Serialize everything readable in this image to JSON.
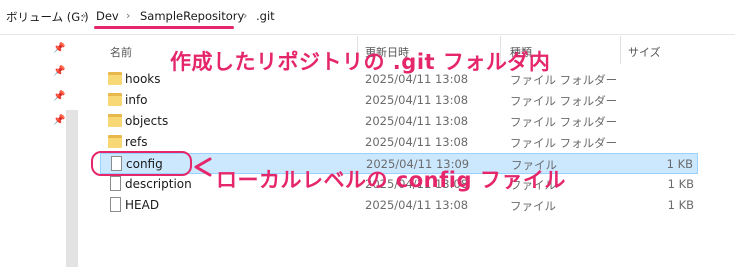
{
  "address_bar": {
    "drive": "ボリューム (G:)",
    "path": [
      "Dev",
      "SampleRepository",
      ".git"
    ],
    "separator": "›"
  },
  "columns": {
    "name": "名前",
    "date": "更新日時",
    "type": "種類",
    "size": "サイズ"
  },
  "rows": [
    {
      "name": "hooks",
      "date": "2025/04/11 13:08",
      "type": "ファイル フォルダー",
      "size": "",
      "icon": "folder-icon"
    },
    {
      "name": "info",
      "date": "2025/04/11 13:08",
      "type": "ファイル フォルダー",
      "size": "",
      "icon": "folder-icon"
    },
    {
      "name": "objects",
      "date": "2025/04/11 13:08",
      "type": "ファイル フォルダー",
      "size": "",
      "icon": "folder-icon"
    },
    {
      "name": "refs",
      "date": "2025/04/11 13:08",
      "type": "ファイル フォルダー",
      "size": "",
      "icon": "folder-icon"
    },
    {
      "name": "config",
      "date": "2025/04/11 13:09",
      "type": "ファイル",
      "size": "1 KB",
      "icon": "file-icon",
      "selected": true
    },
    {
      "name": "description",
      "date": "2025/04/11 13:08",
      "type": "ファイル",
      "size": "1 KB",
      "icon": "file-icon"
    },
    {
      "name": "HEAD",
      "date": "2025/04/11 13:08",
      "type": "ファイル",
      "size": "1 KB",
      "icon": "file-icon"
    }
  ],
  "annotations": {
    "title": "作成したリポジトリの .git フォルダ内",
    "config_label": "ローカルレベルの config ファイル",
    "accent_color": "#e5266b"
  },
  "nav_pins": [
    "pin-icon",
    "pin-icon",
    "pin-icon",
    "pin-icon"
  ]
}
